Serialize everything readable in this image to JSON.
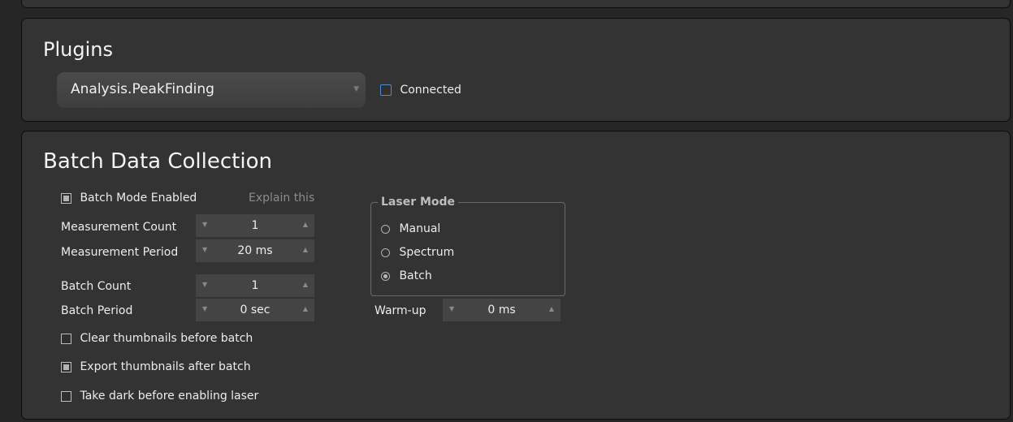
{
  "plugins": {
    "title": "Plugins",
    "selected_plugin": "Analysis.PeakFinding",
    "connected_label": "Connected"
  },
  "batch": {
    "title": "Batch Data Collection",
    "mode_enabled_label": "Batch Mode Enabled",
    "explain_label": "Explain this",
    "measurement_count": {
      "label": "Measurement Count",
      "value": "1"
    },
    "measurement_period": {
      "label": "Measurement Period",
      "value": "20 ms"
    },
    "batch_count": {
      "label": "Batch Count",
      "value": "1"
    },
    "batch_period": {
      "label": "Batch Period",
      "value": "0 sec"
    },
    "clear_thumbnails_label": "Clear thumbnails before batch",
    "export_thumbnails_label": "Export thumbnails after batch",
    "take_dark_label": "Take dark before enabling laser",
    "laser_mode": {
      "legend": "Laser Mode",
      "options": [
        "Manual",
        "Spectrum",
        "Batch"
      ],
      "selected": "Batch"
    },
    "warmup": {
      "label": "Warm-up",
      "value": "0 ms"
    }
  },
  "icons": {
    "spin_down": "▼",
    "spin_up": "▲",
    "dropdown": "▼"
  }
}
